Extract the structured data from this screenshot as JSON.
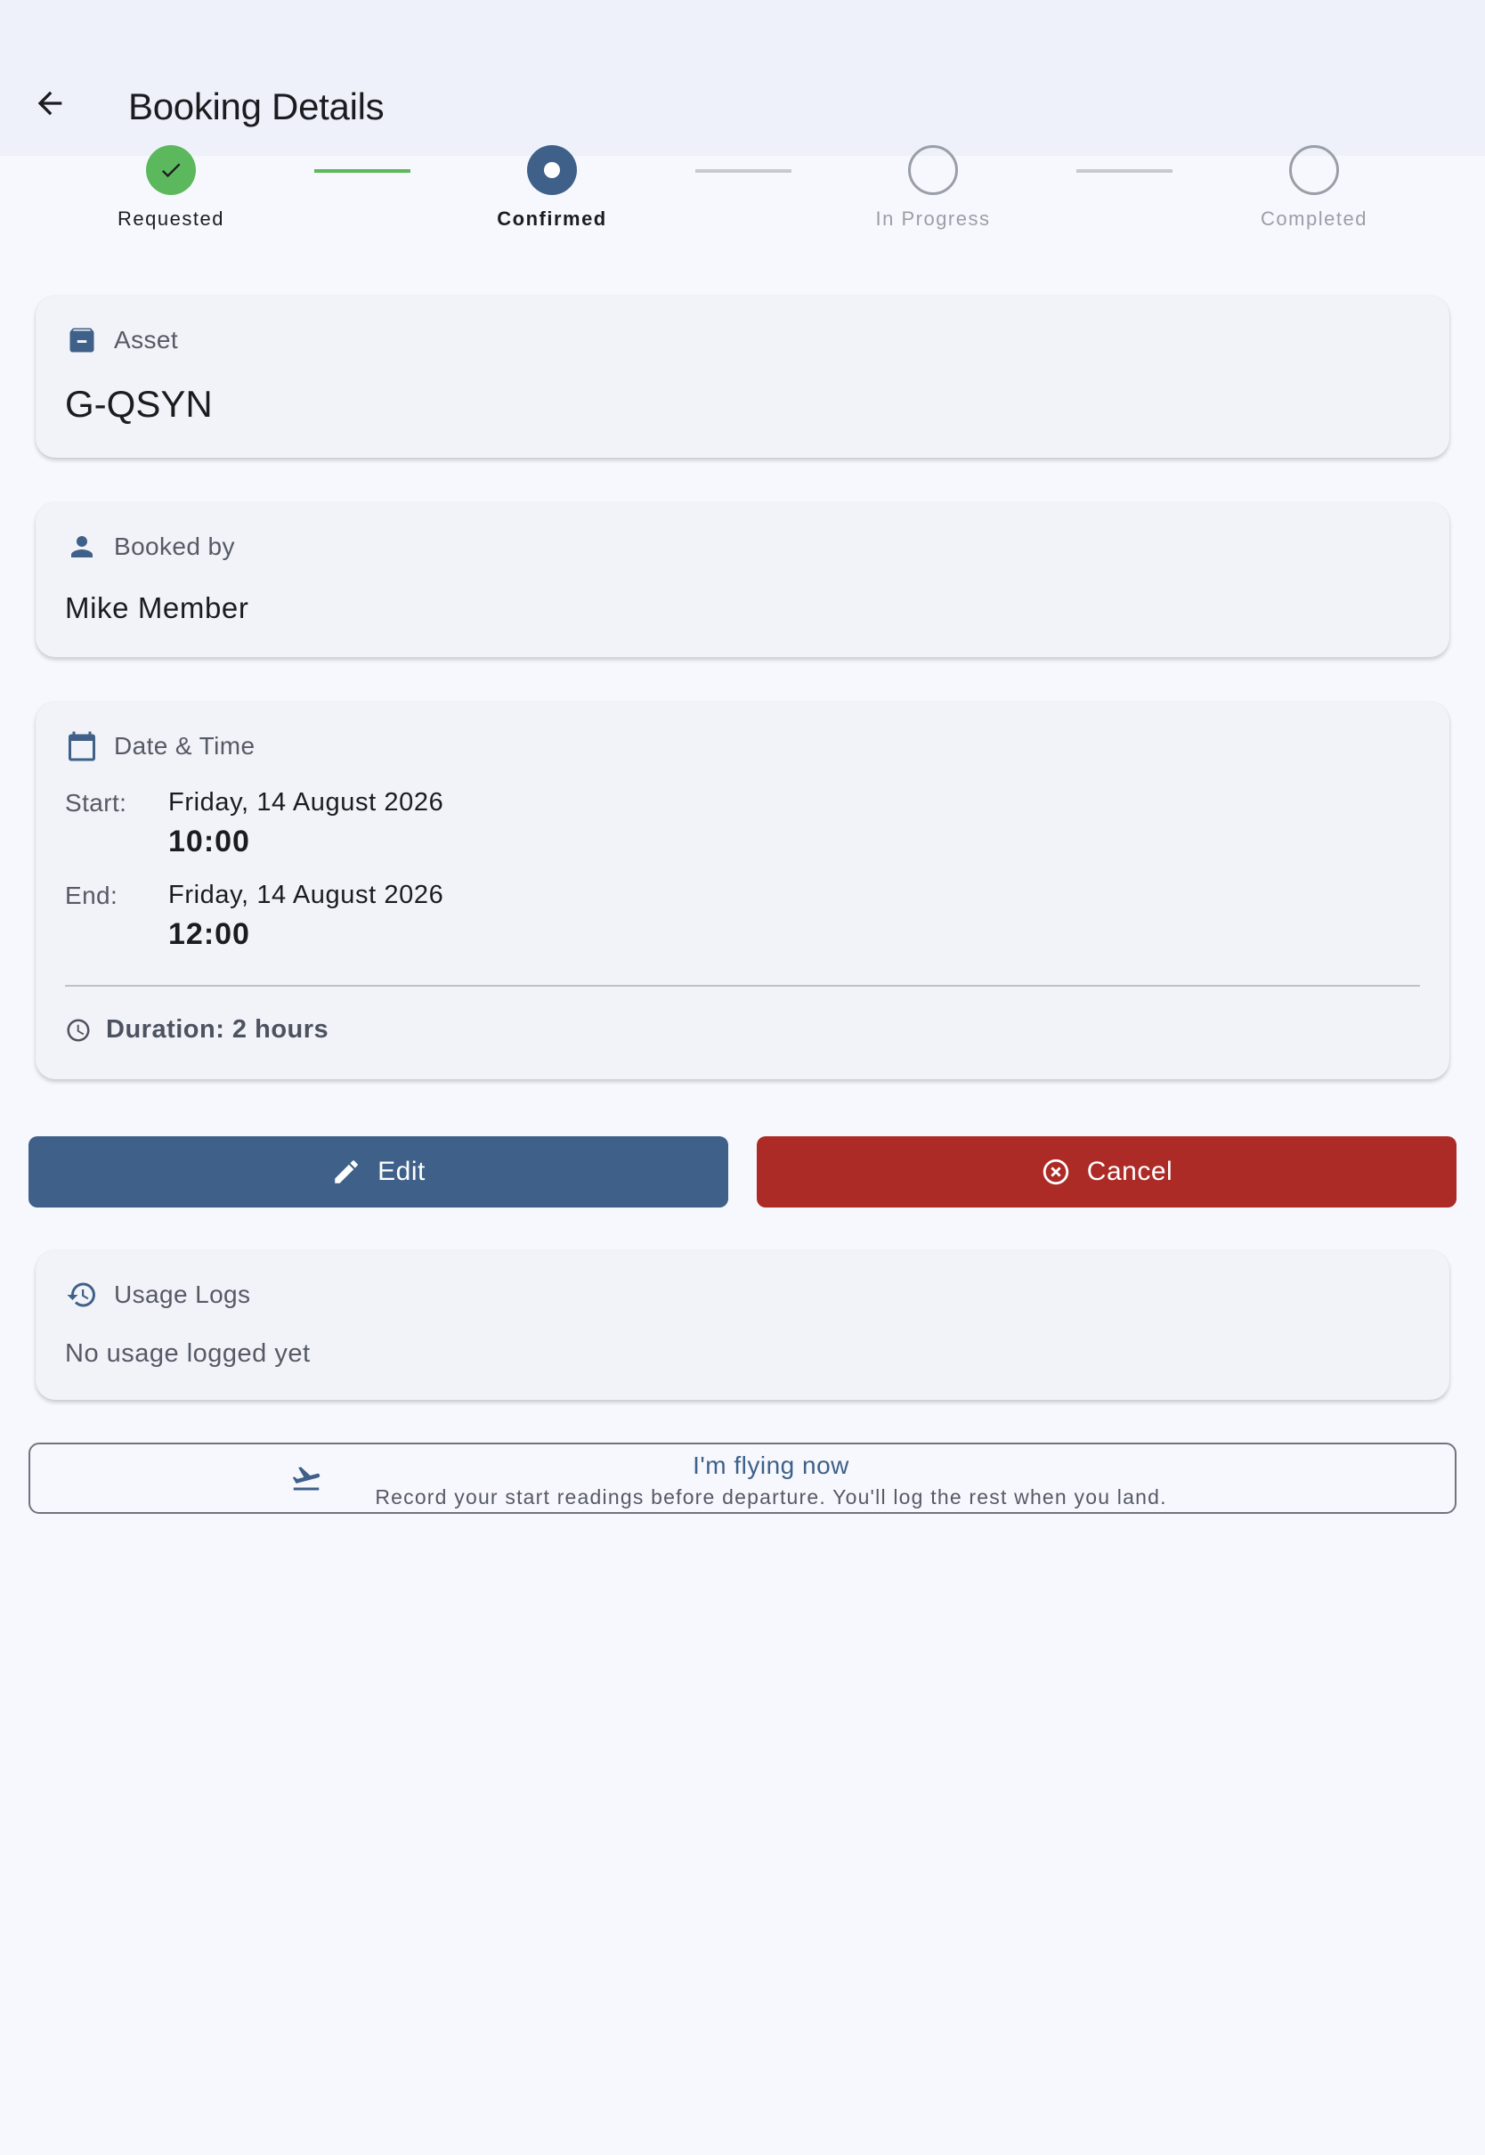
{
  "app_bar": {
    "title": "Booking Details",
    "back_icon": "arrow-back-icon"
  },
  "stepper": {
    "steps": [
      {
        "label": "Requested",
        "state": "done"
      },
      {
        "label": "Confirmed",
        "state": "active"
      },
      {
        "label": "In Progress",
        "state": "pending"
      },
      {
        "label": "Completed",
        "state": "pending"
      }
    ]
  },
  "asset": {
    "icon": "archive-icon",
    "label": "Asset",
    "value": "G-QSYN"
  },
  "booked_by": {
    "icon": "person-icon",
    "label": "Booked by",
    "value": "Mike Member"
  },
  "date_time": {
    "icon": "calendar-icon",
    "label": "Date & Time",
    "start_label": "Start:",
    "start_date": "Friday, 14 August 2026",
    "start_time": "10:00",
    "end_label": "End:",
    "end_date": "Friday, 14 August 2026",
    "end_time": "12:00",
    "duration_icon": "clock-icon",
    "duration": "Duration: 2 hours"
  },
  "actions": {
    "edit_label": "Edit",
    "edit_icon": "pencil-icon",
    "cancel_label": "Cancel",
    "cancel_icon": "cancel-circle-icon"
  },
  "usage_logs": {
    "icon": "history-icon",
    "label": "Usage Logs",
    "empty_text": "No usage logged yet"
  },
  "flying_now": {
    "icon": "flight-takeoff-icon",
    "title": "I'm flying now",
    "subtitle": "Record your start readings before departure. You'll log the rest when you land."
  },
  "colors": {
    "primary": "#3e6089",
    "danger": "#ad2b27",
    "success": "#5cb85c",
    "background": "#f7f8fd"
  }
}
